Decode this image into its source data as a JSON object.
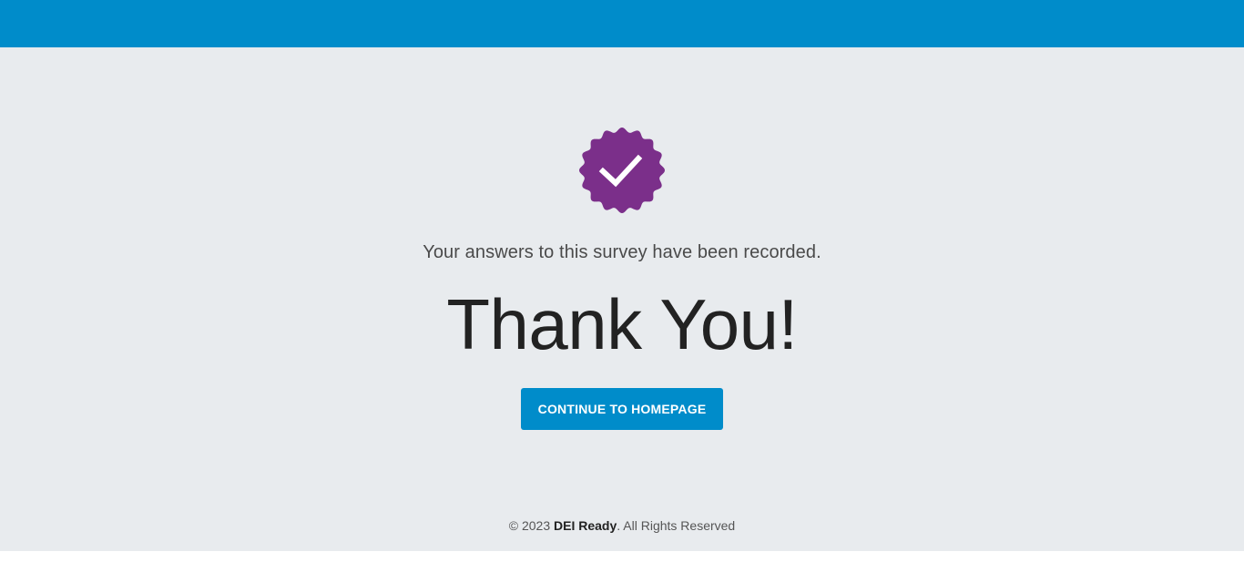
{
  "colors": {
    "topbar": "#008cca",
    "background": "#e8ebee",
    "badge": "#7b2f8a",
    "button": "#008cca",
    "button_text": "#ffffff"
  },
  "badge": {
    "icon": "check-badge-icon"
  },
  "message": {
    "subtitle": "Your answers to this survey have been recorded.",
    "headline": "Thank You!"
  },
  "cta": {
    "label": "CONTINUE TO HOMEPAGE"
  },
  "footer": {
    "copyright_prefix": "© 2023",
    "brand": "DEI Ready",
    "suffix": ". All Rights Reserved"
  }
}
